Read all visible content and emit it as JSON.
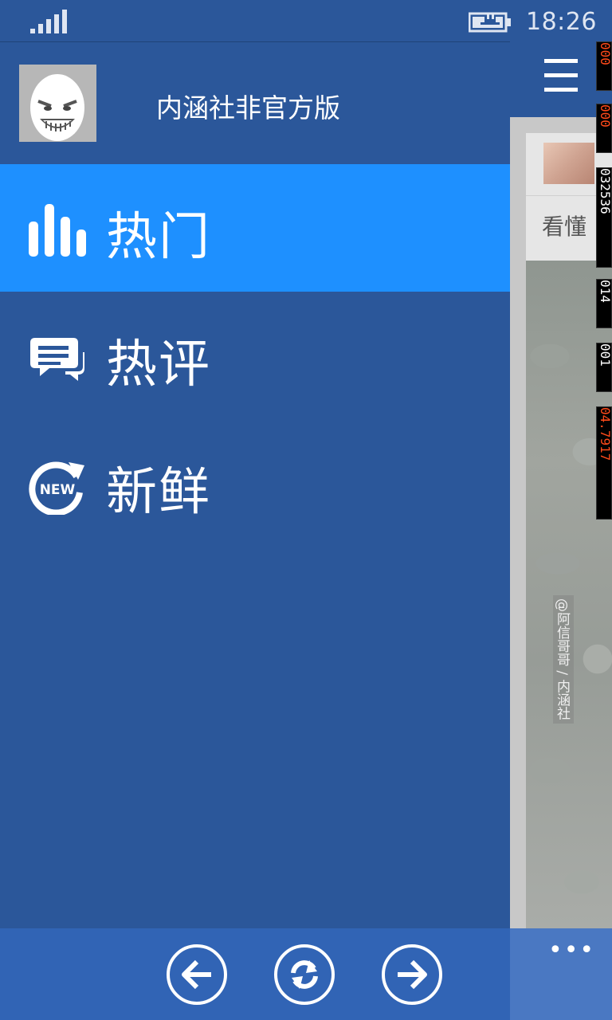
{
  "status_bar": {
    "time": "18:26",
    "signal_icon": "signal-bars-icon",
    "battery_icon": "battery-charging-icon"
  },
  "drawer": {
    "app_title": "内涵社非官方版",
    "menu_items": [
      {
        "label": "热门",
        "icon": "bar-chart-icon",
        "active": true
      },
      {
        "label": "热评",
        "icon": "comment-icon",
        "active": false
      },
      {
        "label": "新鲜",
        "icon": "new-refresh-icon",
        "active": false
      }
    ]
  },
  "content": {
    "post_text": "看懂",
    "watermark": "@阿信哥哥 / 内涵社",
    "more_label": "•••"
  },
  "app_bar": {
    "buttons": [
      {
        "icon": "back-arrow-icon"
      },
      {
        "icon": "refresh-icon"
      },
      {
        "icon": "forward-arrow-icon"
      }
    ]
  },
  "debug_counters": [
    "000",
    "000",
    "032536",
    "014",
    "001",
    "04.7917"
  ],
  "colors": {
    "theme_blue": "#2b579a",
    "active_item": "#1e90ff",
    "app_bar": "#3164b5"
  }
}
